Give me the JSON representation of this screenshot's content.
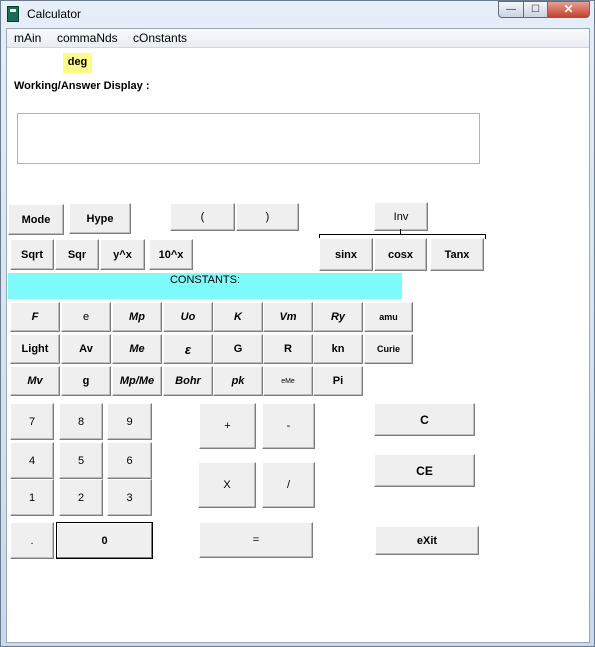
{
  "window": {
    "title": "Calculator",
    "min_glyph": "—",
    "max_glyph": "☐",
    "close_glyph": "✕"
  },
  "menu": {
    "items": [
      "mAin",
      "commaNds",
      "cOnstants"
    ]
  },
  "mode_indicator": "deg",
  "display": {
    "label": "Working/Answer Display :",
    "value": ""
  },
  "buttons": {
    "mode": "Mode",
    "hype": "Hype",
    "lparen": "(",
    "rparen": ")",
    "inv": "Inv",
    "sqrt": "Sqrt",
    "sqr": "Sqr",
    "ypowx": "y^x",
    "tenpowx": "10^x",
    "sinx": "sinx",
    "cosx": "cosx",
    "tanx": "Tanx"
  },
  "constants": {
    "title": "CONSTANTS:",
    "row1": [
      "F",
      "e",
      "Mp",
      "Uo",
      "K",
      "Vm",
      "Ry",
      "amu"
    ],
    "row2": [
      "Light",
      "Av",
      "Me",
      "ε",
      "G",
      "R",
      "kn",
      "Curie"
    ],
    "row3": [
      "Mv",
      "g",
      "Mp/Me",
      "Bohr",
      "pk",
      "eMe",
      "Pi"
    ]
  },
  "keypad": {
    "d7": "7",
    "d8": "8",
    "d9": "9",
    "d4": "4",
    "d5": "5",
    "d6": "6",
    "d1": "1",
    "d2": "2",
    "d3": "3",
    "dot": ".",
    "d0": "0",
    "plus": "+",
    "minus": "-",
    "mult": "X",
    "div": "/",
    "equals": "=",
    "clear": "C",
    "clear_entry": "CE",
    "exit": "eXit"
  }
}
